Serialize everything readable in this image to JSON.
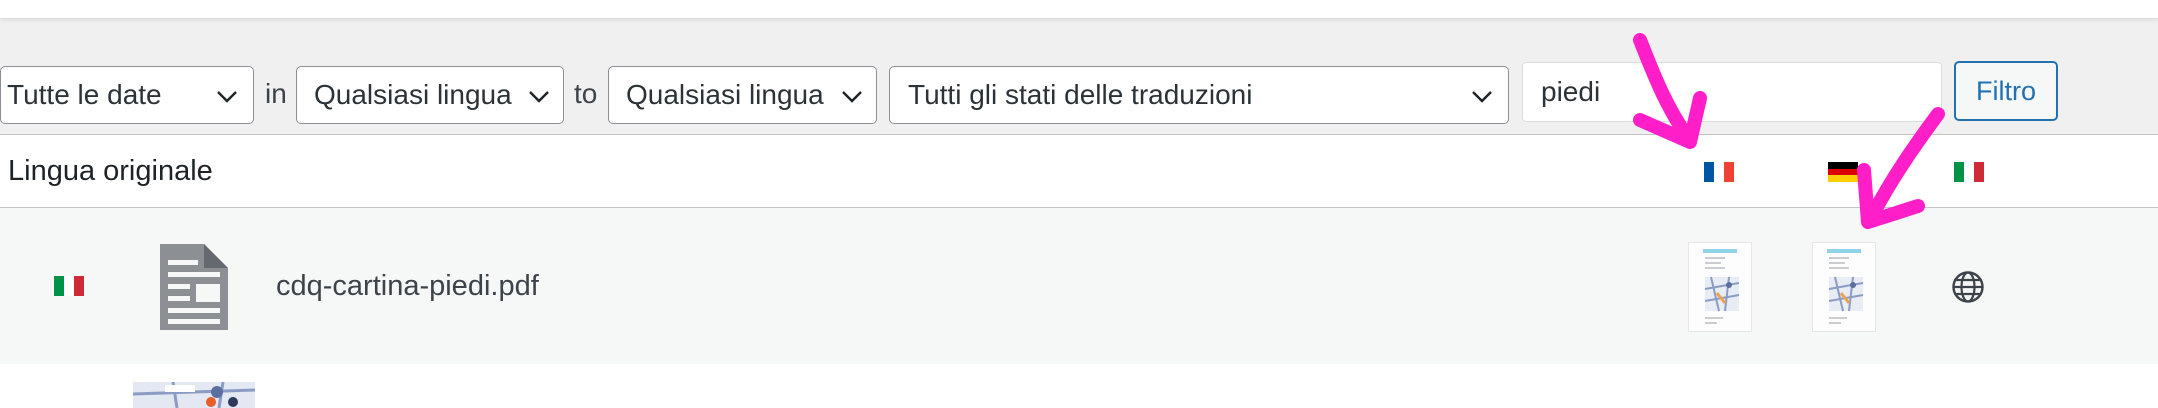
{
  "filters": {
    "date_select": "Tutte le date",
    "sep_in": "in",
    "source_lang_select": "Qualsiasi lingua",
    "sep_to": "to",
    "target_lang_select": "Qualsiasi lingua",
    "status_select": "Tutti gli stati delle traduzioni",
    "search_value": "piedi",
    "filter_button": "Filtro"
  },
  "table": {
    "header_label": "Lingua originale",
    "header_flags": [
      "fr-flag-icon",
      "de-flag-icon",
      "it-flag-icon"
    ],
    "rows": [
      {
        "lang_flag": "it-flag-icon",
        "file_icon": "document-icon",
        "filename": "cdq-cartina-piedi.pdf",
        "translation_thumbs": [
          "map-thumbnail",
          "map-thumbnail"
        ],
        "untranslated_icon": "globe-icon"
      }
    ]
  },
  "colors": {
    "accent": "#2271b1",
    "annotation_arrow": "#ff1ec8",
    "flag_fr": [
      "#0055a4",
      "#ffffff",
      "#ef4135"
    ],
    "flag_de": [
      "#000000",
      "#dd0000",
      "#ffce00"
    ],
    "flag_it": [
      "#009246",
      "#ffffff",
      "#ce2b37"
    ]
  }
}
